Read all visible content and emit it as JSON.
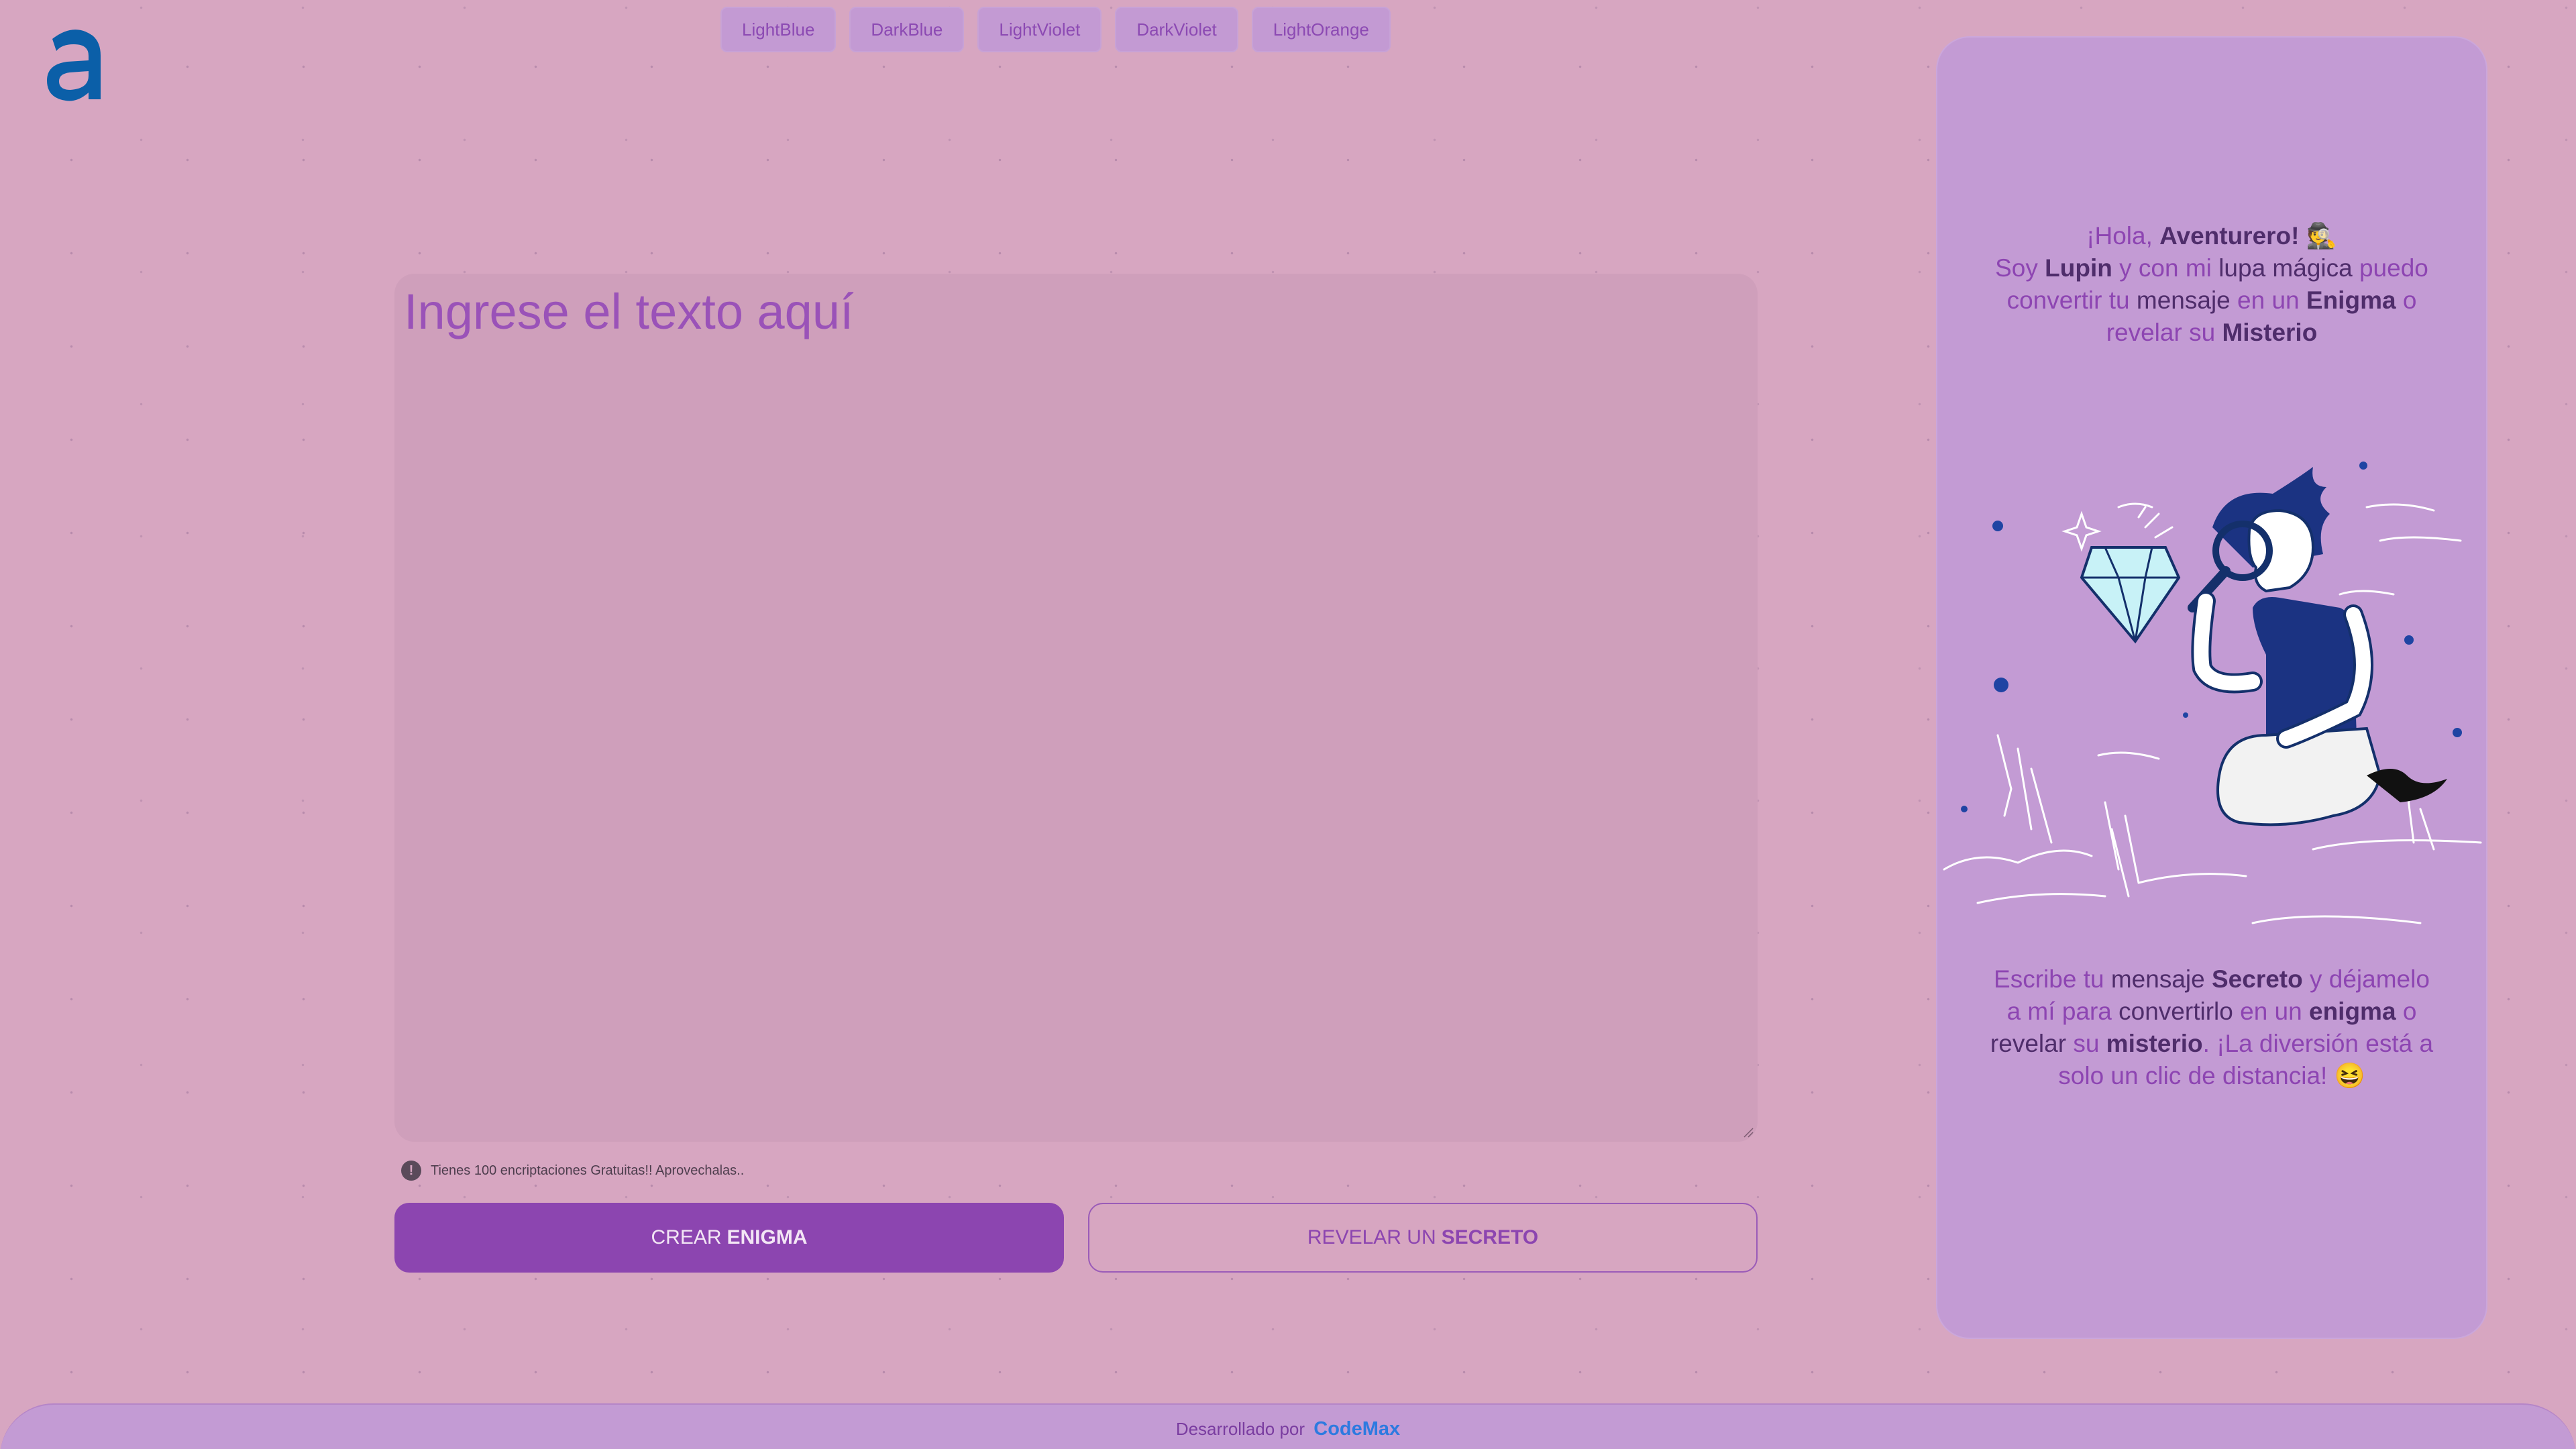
{
  "logo": {
    "letter": "a",
    "color": "#0b5fa8"
  },
  "themes": [
    "LightBlue",
    "DarkBlue",
    "LightViolet",
    "DarkViolet",
    "LightOrange"
  ],
  "editor": {
    "placeholder": "Ingrese el texto aquí"
  },
  "notice": {
    "icon": "!",
    "text": "Tienes 100 encriptaciones Gratuitas!! Aprovechalas.."
  },
  "actions": {
    "encrypt": {
      "prefix": "CREAR",
      "emphasis": "ENIGMA"
    },
    "decrypt": {
      "prefix": "REVELAR UN",
      "emphasis": "SECRETO"
    }
  },
  "side": {
    "greeting": {
      "hello": "¡Hola,",
      "name": "Aventurero!",
      "emoji": "🕵️",
      "line2a": "Soy",
      "lupin": "Lupin",
      "line2b": "y con mi",
      "lupa": "lupa mágica",
      "line2c": "puedo convertir tu",
      "mensaje": "mensaje",
      "line2d": "en un",
      "enigma": "Enigma",
      "line2e": "o revelar su",
      "misterio": "Misterio"
    },
    "message": {
      "p1": "Escribe tu",
      "mensaje": "mensaje",
      "secreto": "Secreto",
      "p2": "y déjamelo a mí para",
      "convertirlo": "convertirlo",
      "p3": "en un",
      "enigma": "enigma",
      "p4": "o",
      "revelar": "revelar",
      "p5": "su",
      "misterio": "misterio",
      "p6": ". ¡La diversión está a solo un clic de distancia!",
      "emoji": "😆"
    }
  },
  "footer": {
    "text": "Desarrollado por",
    "brand": "CodeMax"
  },
  "colors": {
    "background": "#d7a6c1",
    "panel": "#c39bd4",
    "accent": "#8c45b0",
    "brand": "#2d7ae0"
  }
}
